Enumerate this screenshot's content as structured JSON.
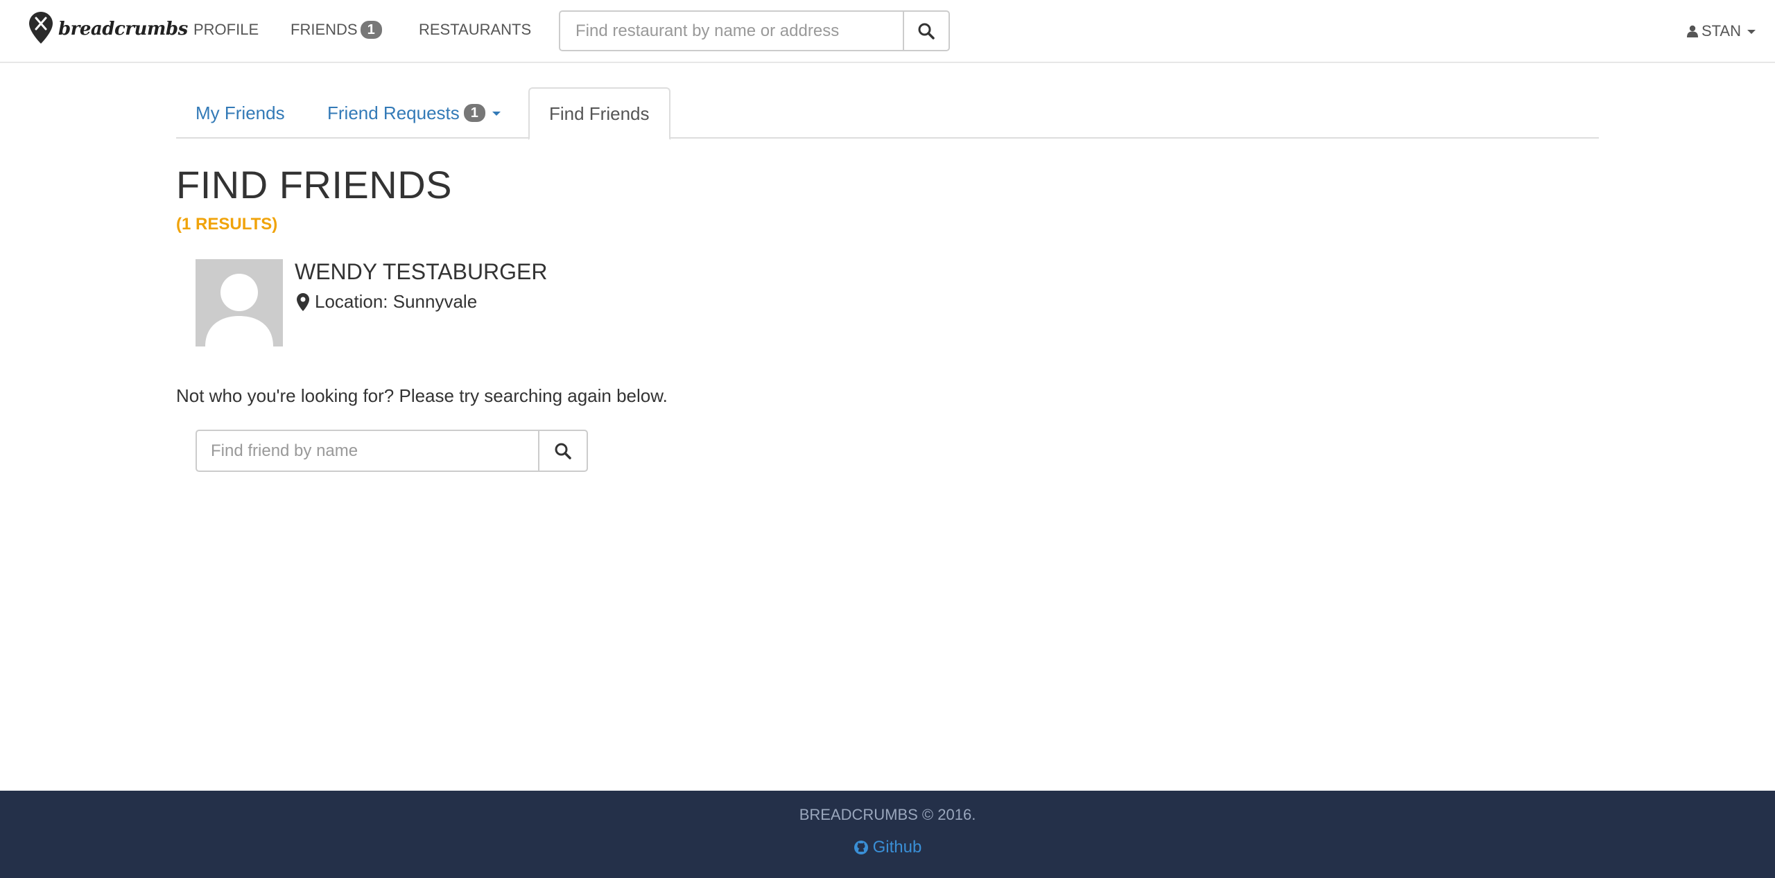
{
  "navbar": {
    "brand": "breadcrumbs",
    "links": [
      {
        "label": "PROFILE"
      },
      {
        "label": "FRIENDS",
        "badge": "1"
      },
      {
        "label": "RESTAURANTS"
      }
    ],
    "search_placeholder": "Find restaurant by name or address",
    "user": "STAN"
  },
  "tabs": [
    {
      "label": "My Friends"
    },
    {
      "label": "Friend Requests",
      "badge": "1"
    },
    {
      "label": "Find Friends"
    }
  ],
  "page": {
    "title": "FIND FRIENDS",
    "results": "(1 RESULTS)",
    "friend": {
      "name": "WENDY TESTABURGER",
      "location": "Location: Sunnyvale"
    },
    "retry_text": "Not who you're looking for? Please try searching again below.",
    "search_placeholder": "Find friend by name"
  },
  "footer": {
    "copyright": "BREADCRUMBS © 2016.",
    "link": "Github"
  },
  "colors": {
    "link": "#337ab7",
    "results_accent": "#f0a30a",
    "footer_bg": "#243049",
    "badge": "#777777"
  }
}
